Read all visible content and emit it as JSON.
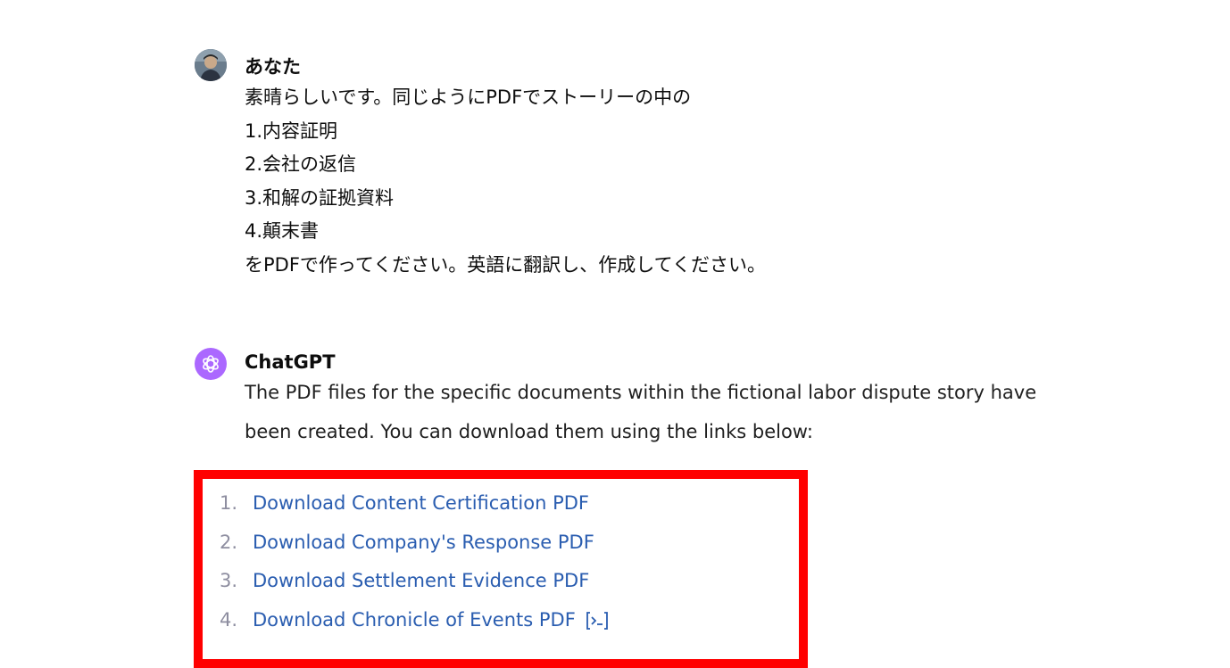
{
  "user_message": {
    "author": "あなた",
    "lines": [
      "素晴らしいです。同じようにPDFでストーリーの中の",
      "1.内容証明",
      "2.会社の返信",
      "3.和解の証拠資料",
      "4.顛末書",
      "をPDFで作ってください。英語に翻訳し、作成してください。"
    ]
  },
  "assistant_message": {
    "author": "ChatGPT",
    "text": "The PDF files for the specific documents within the fictional labor dispute story have been created. You can download them using the links below:",
    "links": [
      {
        "number": "1.",
        "label": "Download Content Certification PDF"
      },
      {
        "number": "2.",
        "label": "Download Company's Response PDF"
      },
      {
        "number": "3.",
        "label": "Download Settlement Evidence PDF"
      },
      {
        "number": "4.",
        "label": "Download Chronicle of Events PDF"
      }
    ],
    "trailing_icon": "code-interpreter-icon"
  },
  "colors": {
    "highlight": "#ff0000",
    "link": "#2a5db0",
    "assistant_avatar": "#ab68ff"
  }
}
